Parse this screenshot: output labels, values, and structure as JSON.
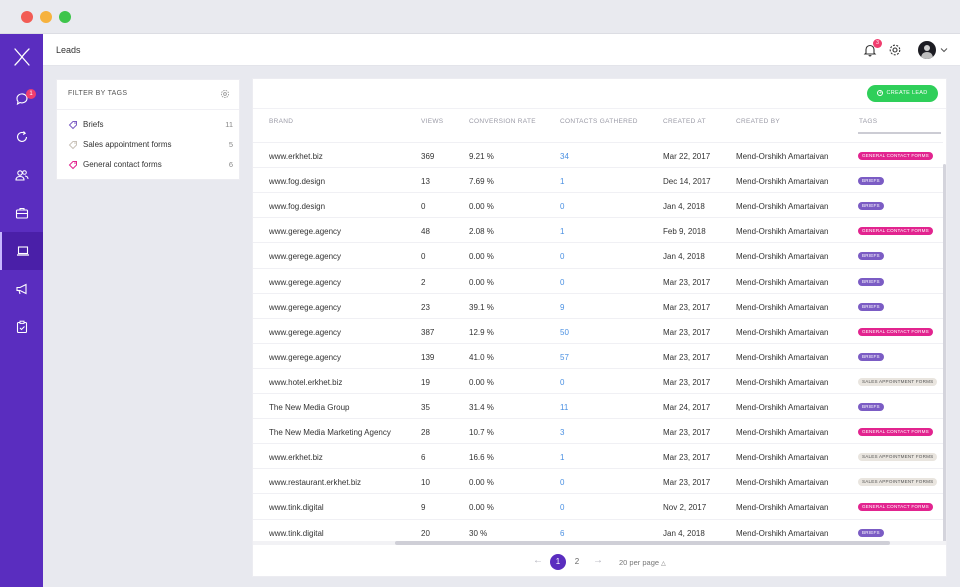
{
  "app": {
    "sidebar": {
      "logo_icon": "x-logo-icon",
      "items": [
        {
          "name": "chat-icon",
          "badge": "1"
        },
        {
          "name": "refresh-icon"
        },
        {
          "name": "users-icon"
        },
        {
          "name": "briefcase-icon"
        },
        {
          "name": "laptop-icon",
          "active": true
        },
        {
          "name": "megaphone-icon"
        },
        {
          "name": "clipboard-icon"
        }
      ]
    },
    "header": {
      "title": "Leads",
      "notification_count": "3"
    }
  },
  "filter": {
    "heading": "FILTER BY TAGS",
    "items": [
      {
        "label": "Briefs",
        "count": "11",
        "color": "#7b5cc4"
      },
      {
        "label": "Sales appointment forms",
        "count": "5",
        "color": "#c9c2b8"
      },
      {
        "label": "General contact forms",
        "count": "6",
        "color": "#e2248f"
      }
    ]
  },
  "table": {
    "create_label": "CREATE LEAD",
    "columns": [
      "BRAND",
      "VIEWS",
      "CONVERSION RATE",
      "CONTACTS GATHERED",
      "CREATED AT",
      "CREATED BY",
      "TAGS"
    ],
    "rows": [
      {
        "brand": "www.erkhet.biz",
        "views": "369",
        "rate": "9.21 %",
        "contacts": "34",
        "created": "Mar 22, 2017",
        "by": "Mend-Orshikh Amartaivan",
        "tag": "GENERAL CONTACT FORMS",
        "tag_type": "general"
      },
      {
        "brand": "www.fog.design",
        "views": "13",
        "rate": "7.69 %",
        "contacts": "1",
        "created": "Dec 14, 2017",
        "by": "Mend-Orshikh Amartaivan",
        "tag": "BRIEFS",
        "tag_type": "briefs"
      },
      {
        "brand": "www.fog.design",
        "views": "0",
        "rate": "0.00 %",
        "contacts": "0",
        "created": "Jan 4, 2018",
        "by": "Mend-Orshikh Amartaivan",
        "tag": "BRIEFS",
        "tag_type": "briefs"
      },
      {
        "brand": "www.gerege.agency",
        "views": "48",
        "rate": "2.08 %",
        "contacts": "1",
        "created": "Feb 9, 2018",
        "by": "Mend-Orshikh Amartaivan",
        "tag": "GENERAL CONTACT FORMS",
        "tag_type": "general"
      },
      {
        "brand": "www.gerege.agency",
        "views": "0",
        "rate": "0.00 %",
        "contacts": "0",
        "created": "Jan 4, 2018",
        "by": "Mend-Orshikh Amartaivan",
        "tag": "BRIEFS",
        "tag_type": "briefs"
      },
      {
        "brand": "www.gerege.agency",
        "views": "2",
        "rate": "0.00 %",
        "contacts": "0",
        "created": "Mar 23, 2017",
        "by": "Mend-Orshikh Amartaivan",
        "tag": "BRIEFS",
        "tag_type": "briefs"
      },
      {
        "brand": "www.gerege.agency",
        "views": "23",
        "rate": "39.1 %",
        "contacts": "9",
        "created": "Mar 23, 2017",
        "by": "Mend-Orshikh Amartaivan",
        "tag": "BRIEFS",
        "tag_type": "briefs"
      },
      {
        "brand": "www.gerege.agency",
        "views": "387",
        "rate": "12.9 %",
        "contacts": "50",
        "created": "Mar 23, 2017",
        "by": "Mend-Orshikh Amartaivan",
        "tag": "GENERAL CONTACT FORMS",
        "tag_type": "general"
      },
      {
        "brand": "www.gerege.agency",
        "views": "139",
        "rate": "41.0 %",
        "contacts": "57",
        "created": "Mar 23, 2017",
        "by": "Mend-Orshikh Amartaivan",
        "tag": "BRIEFS",
        "tag_type": "briefs"
      },
      {
        "brand": "www.hotel.erkhet.biz",
        "views": "19",
        "rate": "0.00 %",
        "contacts": "0",
        "created": "Mar 23, 2017",
        "by": "Mend-Orshikh Amartaivan",
        "tag": "SALES APPOINTMENT FORMS",
        "tag_type": "sales"
      },
      {
        "brand": "The New Media Group",
        "views": "35",
        "rate": "31.4 %",
        "contacts": "11",
        "created": "Mar 24, 2017",
        "by": "Mend-Orshikh Amartaivan",
        "tag": "BRIEFS",
        "tag_type": "briefs"
      },
      {
        "brand": "The New Media Marketing Agency",
        "views": "28",
        "rate": "10.7 %",
        "contacts": "3",
        "created": "Mar 23, 2017",
        "by": "Mend-Orshikh Amartaivan",
        "tag": "GENERAL CONTACT FORMS",
        "tag_type": "general"
      },
      {
        "brand": "www.erkhet.biz",
        "views": "6",
        "rate": "16.6 %",
        "contacts": "1",
        "created": "Mar 23, 2017",
        "by": "Mend-Orshikh Amartaivan",
        "tag": "SALES APPOINTMENT FORMS",
        "tag_type": "sales"
      },
      {
        "brand": "www.restaurant.erkhet.biz",
        "views": "10",
        "rate": "0.00 %",
        "contacts": "0",
        "created": "Mar 23, 2017",
        "by": "Mend-Orshikh Amartaivan",
        "tag": "SALES APPOINTMENT FORMS",
        "tag_type": "sales"
      },
      {
        "brand": "www.tink.digital",
        "views": "9",
        "rate": "0.00 %",
        "contacts": "0",
        "created": "Nov 2, 2017",
        "by": "Mend-Orshikh Amartaivan",
        "tag": "GENERAL CONTACT FORMS",
        "tag_type": "general"
      },
      {
        "brand": "www.tink.digital",
        "views": "20",
        "rate": "30 %",
        "contacts": "6",
        "created": "Jan 4, 2018",
        "by": "Mend-Orshikh Amartaivan",
        "tag": "BRIEFS",
        "tag_type": "briefs"
      }
    ],
    "tag_colors": {
      "general": {
        "bg": "#e2248f",
        "fg": "#ffffff"
      },
      "briefs": {
        "bg": "#7b5cc4",
        "fg": "#ffffff"
      },
      "sales": {
        "bg": "#e9e5df",
        "fg": "#555555"
      }
    }
  },
  "pagination": {
    "prev_icon": "arrow-left-icon",
    "next_icon": "arrow-right-icon",
    "pages": [
      "1",
      "2"
    ],
    "current": "1",
    "per_page": "20 per page"
  },
  "colors": {
    "accent": "#5a2dbf",
    "create_button": "#2fcf5a",
    "link": "#4a90e2"
  }
}
